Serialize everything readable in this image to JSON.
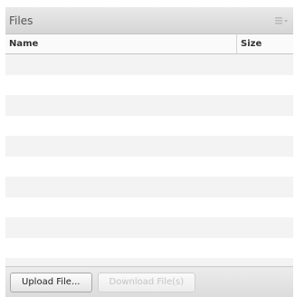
{
  "panel": {
    "title": "Files",
    "menu_icon": "panel-menu-icon"
  },
  "table": {
    "columns": [
      "Name",
      "Size"
    ],
    "rows": []
  },
  "footer": {
    "upload_label": "Upload File...",
    "download_label": "Download File(s)"
  }
}
